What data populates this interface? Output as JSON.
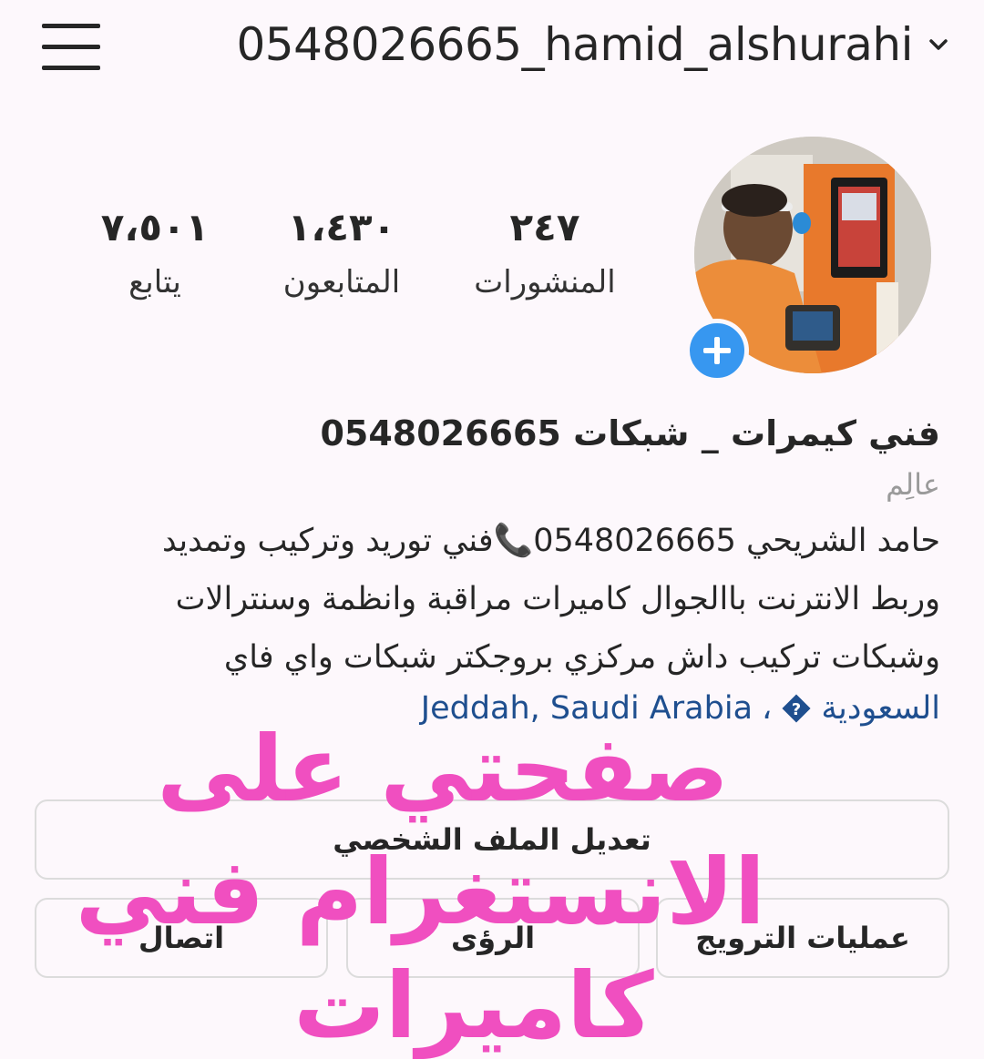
{
  "header": {
    "username": "0548026665_hamid_alshurahi"
  },
  "stats": [
    {
      "value": "٢٤٧",
      "label": "المنشورات"
    },
    {
      "value": "١،٤٣٠",
      "label": "المتابعون"
    },
    {
      "value": "٧،٥٠١",
      "label": "يتابع"
    }
  ],
  "bio": {
    "name": "فني كيمرات _ شبكات  0548026665",
    "category": "عالِم",
    "text_line1": "حامد الشريحي 0548026665📞فني توريد وتركيب وتمديد",
    "text_line2": "وربط الانترنت باالجوال كاميرات مراقبة وانظمة وسنترالات",
    "text_line3": "وشبكات تركيب داش مركزي بروجكتر شبكات واي فاي",
    "location_country": "السعودية",
    "location_sep": "،",
    "location_city": "Jeddah, Saudi Arabia"
  },
  "buttons": {
    "edit_profile": "تعديل الملف الشخصي",
    "promotions": "عمليات الترويج",
    "insights": "الرؤى",
    "contact": "اتصال"
  },
  "overlay": {
    "line1": "صفحتي على",
    "line2": "الانستغرام فني",
    "line3": "كاميرات"
  },
  "colors": {
    "accent_blue": "#3797f0",
    "overlay_pink": "#f04fc0",
    "location_blue": "#1f4f8f"
  }
}
